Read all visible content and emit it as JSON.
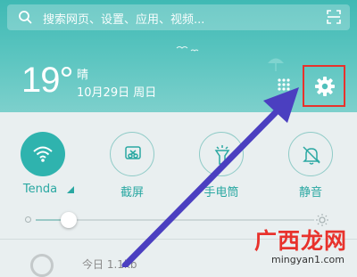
{
  "search": {
    "placeholder": "搜索网页、设置、应用、视频..."
  },
  "weather": {
    "temperature": "19°",
    "condition": "晴",
    "date": "10月29日 周日"
  },
  "toggles": [
    {
      "label": "Tenda",
      "state": "on"
    },
    {
      "label": "截屏",
      "state": "off"
    },
    {
      "label": "手电筒",
      "state": "off"
    },
    {
      "label": "静音",
      "state": "off"
    }
  ],
  "brightness": {
    "level": 0.12
  },
  "bottom_item": {
    "text": "今日 1.1kb"
  },
  "watermark": {
    "brand": "广西龙网",
    "url": "mingyan1.com"
  },
  "colors": {
    "header": "#3fb9b4",
    "accent": "#2fb3ae",
    "highlight_box": "#e8322c",
    "arrow": "#4b3fc0"
  }
}
